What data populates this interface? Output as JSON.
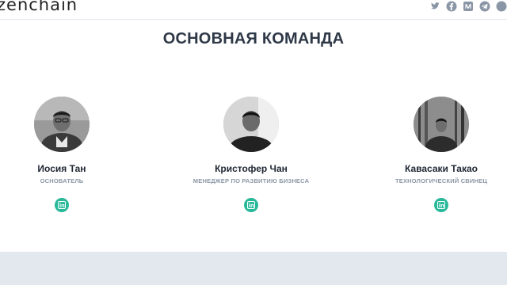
{
  "header": {
    "logo_text": "zenchain",
    "social_icons": [
      "twitter-icon",
      "facebook-icon",
      "medium-icon",
      "telegram-icon",
      "other-icon"
    ],
    "icon_color": "#8a96a6"
  },
  "section": {
    "title": "ОСНОВНАЯ КОМАНДА"
  },
  "team": [
    {
      "name": "Иосия Тан",
      "role": "ОСНОВАТЕЛЬ",
      "social": "linkedin-icon"
    },
    {
      "name": "Кристофер Чан",
      "role": "МЕНЕДЖЕР ПО РАЗВИТИЮ БИЗНЕСА",
      "social": "linkedin-icon"
    },
    {
      "name": "Кавасаки Такао",
      "role": "ТЕХНОЛОГИЧЕСКИЙ СВИНЕЦ",
      "social": "linkedin-icon"
    }
  ],
  "colors": {
    "title": "#2e3847",
    "role": "#8a96a6",
    "accent": "#28b89a",
    "footer_band": "#e3e8ef"
  }
}
